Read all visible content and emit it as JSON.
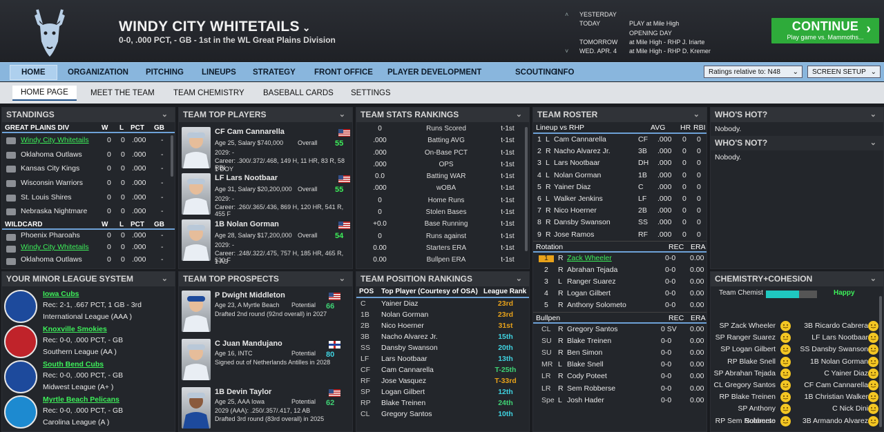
{
  "header": {
    "team_name": "WINDY CITY WHITETAILS",
    "subtitle": "0-0, .000 PCT, - GB - 1st in the WL Great Plains Division",
    "schedule": [
      {
        "day": "YESTERDAY",
        "event": ""
      },
      {
        "day": "TODAY",
        "event": "PLAY at Mile High"
      },
      {
        "day": "",
        "event": "OPENING DAY"
      },
      {
        "day": "TOMORROW",
        "event": "at Mile High - RHP J. Iriarte"
      },
      {
        "day": "WED. APR. 4",
        "event": "at Mile High - RHP D. Kremer"
      }
    ],
    "continue_label": "CONTINUE",
    "continue_sub": "Play game vs. Mammoths..."
  },
  "nav": {
    "items": [
      "HOME",
      "ORGANIZATION",
      "PITCHING",
      "LINEUPS",
      "STRATEGY",
      "FRONT OFFICE",
      "PLAYER DEVELOPMENT",
      "SCOUTING",
      "INFO"
    ],
    "ratings_label": "Ratings relative to: N48",
    "screen_setup": "SCREEN SETUP"
  },
  "subnav": {
    "items": [
      "HOME PAGE",
      "MEET THE TEAM",
      "TEAM CHEMISTRY",
      "BASEBALL CARDS",
      "SETTINGS"
    ]
  },
  "standings": {
    "title": "STANDINGS",
    "div_name": "GREAT PLAINS DIV",
    "cols": [
      "W",
      "L",
      "PCT",
      "GB"
    ],
    "div_rows": [
      {
        "team": "Windy City Whitetails",
        "w": "0",
        "l": "0",
        "pct": ".000",
        "gb": "-",
        "link": true
      },
      {
        "team": "Oklahoma Outlaws",
        "w": "0",
        "l": "0",
        "pct": ".000",
        "gb": "-",
        "link": false
      },
      {
        "team": "Kansas City Kings",
        "w": "0",
        "l": "0",
        "pct": ".000",
        "gb": "-",
        "link": false
      },
      {
        "team": "Wisconsin Warriors",
        "w": "0",
        "l": "0",
        "pct": ".000",
        "gb": "-",
        "link": false
      },
      {
        "team": "St. Louis Shires",
        "w": "0",
        "l": "0",
        "pct": ".000",
        "gb": "-",
        "link": false
      },
      {
        "team": "Nebraska Nightmare",
        "w": "0",
        "l": "0",
        "pct": ".000",
        "gb": "-",
        "link": false
      }
    ],
    "wc_name": "WILDCARD",
    "wc_rows": [
      {
        "team": "Phoenix Pharoahs",
        "w": "0",
        "l": "0",
        "pct": ".000",
        "gb": "-",
        "link": false
      },
      {
        "team": "Windy City Whitetails",
        "w": "0",
        "l": "0",
        "pct": ".000",
        "gb": "-",
        "link": true
      },
      {
        "team": "Oklahoma Outlaws",
        "w": "0",
        "l": "0",
        "pct": ".000",
        "gb": "-",
        "link": false
      }
    ]
  },
  "top_players": {
    "title": "TEAM TOP PLAYERS",
    "players": [
      {
        "name": "CF Cam Cannarella",
        "info": "Age 25, Salary $740,000",
        "overall_label": "Overall",
        "overall": "55",
        "line1": "2029: -",
        "line2": "Career: .300/.372/.468, 149 H, 11 HR, 83 R, 58 RBI",
        "line3": "1 DOY"
      },
      {
        "name": "LF Lars Nootbaar",
        "info": "Age 31, Salary $20,200,000",
        "overall_label": "Overall",
        "overall": "55",
        "line1": "2029: -",
        "line2": "Career: .260/.365/.436, 869 H, 120 HR, 541 R, 455 F",
        "line3": ""
      },
      {
        "name": "1B Nolan Gorman",
        "info": "Age 28, Salary $17,200,000",
        "overall_label": "Overall",
        "overall": "54",
        "line1": "2029: -",
        "line2": "Career: .248/.322/.475, 757 H, 185 HR, 465 R, 530 F",
        "line3": "1 AS"
      }
    ]
  },
  "team_stats": {
    "title": "TEAM STATS RANKINGS",
    "rows": [
      {
        "v": "0",
        "n": "Runs Scored",
        "r": "t-1st"
      },
      {
        "v": ".000",
        "n": "Batting AVG",
        "r": "t-1st"
      },
      {
        "v": ".000",
        "n": "On-Base PCT",
        "r": "t-1st"
      },
      {
        "v": ".000",
        "n": "OPS",
        "r": "t-1st"
      },
      {
        "v": "0.0",
        "n": "Batting WAR",
        "r": "t-1st"
      },
      {
        "v": ".000",
        "n": "wOBA",
        "r": "t-1st"
      },
      {
        "v": "0",
        "n": "Home Runs",
        "r": "t-1st"
      },
      {
        "v": "0",
        "n": "Stolen Bases",
        "r": "t-1st"
      },
      {
        "v": "+0.0",
        "n": "Base Running",
        "r": "t-1st"
      },
      {
        "v": "0",
        "n": "Runs against",
        "r": "t-1st"
      },
      {
        "v": "0.00",
        "n": "Starters ERA",
        "r": "t-1st"
      },
      {
        "v": "0.00",
        "n": "Bullpen ERA",
        "r": "t-1st"
      }
    ]
  },
  "roster": {
    "title": "TEAM ROSTER",
    "lineup_header": "Lineup vs RHP",
    "lineup_cols": [
      "AVG",
      "HR",
      "RBI"
    ],
    "lineup": [
      {
        "n": "1",
        "h": "L",
        "name": "Cam Cannarella",
        "pos": "CF",
        "avg": ".000",
        "hr": "0",
        "rbi": "0"
      },
      {
        "n": "2",
        "h": "R",
        "name": "Nacho Alvarez Jr.",
        "pos": "3B",
        "avg": ".000",
        "hr": "0",
        "rbi": "0"
      },
      {
        "n": "3",
        "h": "L",
        "name": "Lars Nootbaar",
        "pos": "DH",
        "avg": ".000",
        "hr": "0",
        "rbi": "0"
      },
      {
        "n": "4",
        "h": "L",
        "name": "Nolan Gorman",
        "pos": "1B",
        "avg": ".000",
        "hr": "0",
        "rbi": "0"
      },
      {
        "n": "5",
        "h": "R",
        "name": "Yainer Diaz",
        "pos": "C",
        "avg": ".000",
        "hr": "0",
        "rbi": "0"
      },
      {
        "n": "6",
        "h": "L",
        "name": "Walker Jenkins",
        "pos": "LF",
        "avg": ".000",
        "hr": "0",
        "rbi": "0"
      },
      {
        "n": "7",
        "h": "R",
        "name": "Nico Hoerner",
        "pos": "2B",
        "avg": ".000",
        "hr": "0",
        "rbi": "0"
      },
      {
        "n": "8",
        "h": "R",
        "name": "Dansby Swanson",
        "pos": "SS",
        "avg": ".000",
        "hr": "0",
        "rbi": "0"
      },
      {
        "n": "9",
        "h": "R",
        "name": "Jose Ramos",
        "pos": "RF",
        "avg": ".000",
        "hr": "0",
        "rbi": "0"
      }
    ],
    "rotation_header": "Rotation",
    "pitch_cols": [
      "REC",
      "ERA"
    ],
    "rotation": [
      {
        "n": "1",
        "h": "R",
        "name": "Zack Wheeler",
        "rec": "0-0",
        "era": "0.00",
        "link": true
      },
      {
        "n": "2",
        "h": "R",
        "name": "Abrahan Tejada",
        "rec": "0-0",
        "era": "0.00",
        "link": false
      },
      {
        "n": "3",
        "h": "L",
        "name": "Ranger Suarez",
        "rec": "0-0",
        "era": "0.00",
        "link": false
      },
      {
        "n": "4",
        "h": "R",
        "name": "Logan Gilbert",
        "rec": "0-0",
        "era": "0.00",
        "link": false
      },
      {
        "n": "5",
        "h": "R",
        "name": "Anthony Solometo",
        "rec": "0-0",
        "era": "0.00",
        "link": false
      }
    ],
    "bullpen_header": "Bullpen",
    "bullpen": [
      {
        "n": "CL",
        "h": "R",
        "name": "Gregory Santos",
        "rec": "0 SV",
        "era": "0.00"
      },
      {
        "n": "SU",
        "h": "R",
        "name": "Blake Treinen",
        "rec": "0-0",
        "era": "0.00"
      },
      {
        "n": "SU",
        "h": "R",
        "name": "Ben Simon",
        "rec": "0-0",
        "era": "0.00"
      },
      {
        "n": "MR",
        "h": "L",
        "name": "Blake Snell",
        "rec": "0-0",
        "era": "0.00"
      },
      {
        "n": "LR",
        "h": "R",
        "name": "Cody Poteet",
        "rec": "0-0",
        "era": "0.00"
      },
      {
        "n": "LR",
        "h": "R",
        "name": "Sem Robberse",
        "rec": "0-0",
        "era": "0.00"
      },
      {
        "n": "Spe",
        "h": "L",
        "name": "Josh Hader",
        "rec": "0-0",
        "era": "0.00"
      }
    ]
  },
  "hot": {
    "title": "WHO'S HOT?",
    "hot_text": "Nobody.",
    "not_title": "WHO'S NOT?",
    "not_text": "Nobody."
  },
  "minors": {
    "title": "YOUR MINOR LEAGUE SYSTEM",
    "teams": [
      {
        "name": "Iowa Cubs",
        "rec": "Rec: 2-1, .667 PCT, 1 GB - 3rd",
        "league": "International League (AAA )"
      },
      {
        "name": "Knoxville Smokies",
        "rec": "Rec: 0-0, .000 PCT, - GB",
        "league": "Southern League (AA )"
      },
      {
        "name": "South Bend Cubs",
        "rec": "Rec: 0-0, .000 PCT, - GB",
        "league": "Midwest League (A+ )"
      },
      {
        "name": "Myrtle Beach Pelicans",
        "rec": "Rec: 0-0, .000 PCT, - GB",
        "league": "Carolina League (A )"
      }
    ]
  },
  "prospects": {
    "title": "TEAM TOP PROSPECTS",
    "players": [
      {
        "name": "P Dwight Middleton",
        "info": "Age 23, A Myrtle Beach",
        "pot_label": "Potential",
        "pot": "66",
        "line1": "Drafted 2nd round (92nd overall) in 2027",
        "line2": ""
      },
      {
        "name": "C Juan Mandujano",
        "info": "Age 16, INTC",
        "pot_label": "Potential",
        "pot": "80",
        "line1": "Signed out of Netherlands Antilles in 2028",
        "line2": ""
      },
      {
        "name": "1B Devin Taylor",
        "info": "Age 25, AAA Iowa",
        "pot_label": "Potential",
        "pot": "62",
        "line1": "2029 (AAA): .250/.357/.417, 12 AB",
        "line2": "Drafted 3rd round (83rd overall) in 2025"
      }
    ]
  },
  "positions": {
    "title": "TEAM POSITION RANKINGS",
    "cols": [
      "POS",
      "Top Player (Courtesy of OSA)",
      "League Rank"
    ],
    "rows": [
      {
        "pos": "C",
        "player": "Yainer Diaz",
        "rank": "23rd",
        "color": "#e8a21a"
      },
      {
        "pos": "1B",
        "player": "Nolan Gorman",
        "rank": "23rd",
        "color": "#e8a21a"
      },
      {
        "pos": "2B",
        "player": "Nico Hoerner",
        "rank": "31st",
        "color": "#e8a21a"
      },
      {
        "pos": "3B",
        "player": "Nacho Alvarez Jr.",
        "rank": "15th",
        "color": "#3fd2e0"
      },
      {
        "pos": "SS",
        "player": "Dansby Swanson",
        "rank": "20th",
        "color": "#3fd2e0"
      },
      {
        "pos": "LF",
        "player": "Lars Nootbaar",
        "rank": "13th",
        "color": "#3fd2e0"
      },
      {
        "pos": "CF",
        "player": "Cam Cannarella",
        "rank": "T-25th",
        "color": "#3fd274"
      },
      {
        "pos": "RF",
        "player": "Jose Vasquez",
        "rank": "T-33rd",
        "color": "#e8a21a"
      },
      {
        "pos": "SP",
        "player": "Logan Gilbert",
        "rank": "12th",
        "color": "#3fd2e0"
      },
      {
        "pos": "RP",
        "player": "Blake Treinen",
        "rank": "24th",
        "color": "#3fd274"
      },
      {
        "pos": "CL",
        "player": "Gregory Santos",
        "rank": "10th",
        "color": "#3fd2e0"
      }
    ]
  },
  "chemistry": {
    "title": "CHEMISTRY+COHESION",
    "label": "Team Chemist",
    "mood": "Happy",
    "level": 0.65,
    "left": [
      "SP Zack Wheeler",
      "SP Ranger Suarez",
      "SP Logan Gilbert",
      "RP Blake Snell",
      "SP Abrahan Tejada",
      "CL Gregory Santos",
      "RP Blake Treinen",
      "SP Anthony Solometo",
      "RP Sem Robberse"
    ],
    "right": [
      "3B Ricardo Cabrera",
      "LF Lars Nootbaar",
      "SS Dansby Swanson",
      "1B Nolan Gorman",
      "C Yainer Diaz",
      "CF Cam Cannarella",
      "1B Christian Walker",
      "C Nick Dini",
      "3B Armando Alvarez"
    ]
  },
  "colors": {
    "accent": "#6ea2d8",
    "link": "#3df05a",
    "continue": "#2eab3a",
    "nav": "#89b6dd"
  }
}
